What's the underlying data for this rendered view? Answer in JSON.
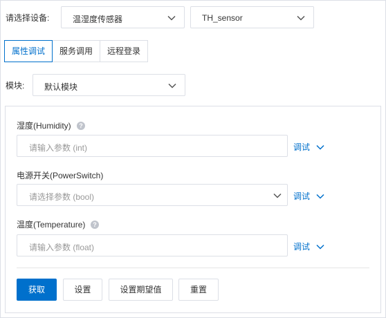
{
  "device": {
    "label": "请选择设备:",
    "product_select": "温湿度传感器",
    "device_select": "TH_sensor"
  },
  "tabs": [
    {
      "label": "属性调试",
      "active": true
    },
    {
      "label": "服务调用",
      "active": false
    },
    {
      "label": "远程登录",
      "active": false
    }
  ],
  "module": {
    "label": "模块:",
    "value": "默认模块"
  },
  "properties": [
    {
      "label": "湿度(Humidity)",
      "has_help": true,
      "placeholder": "请输入参数 (int)",
      "kind": "input",
      "action": "调试"
    },
    {
      "label": "电源开关(PowerSwitch)",
      "has_help": false,
      "placeholder": "请选择参数 (bool)",
      "kind": "select",
      "action": "调试"
    },
    {
      "label": "温度(Temperature)",
      "has_help": true,
      "placeholder": "请输入参数 (float)",
      "kind": "input",
      "action": "调试"
    }
  ],
  "buttons": {
    "get": "获取",
    "set": "设置",
    "set_expected": "设置期望值",
    "reset": "重置"
  },
  "colors": {
    "accent": "#0070cc",
    "border": "#dcdfe6",
    "placeholder": "#999999"
  }
}
